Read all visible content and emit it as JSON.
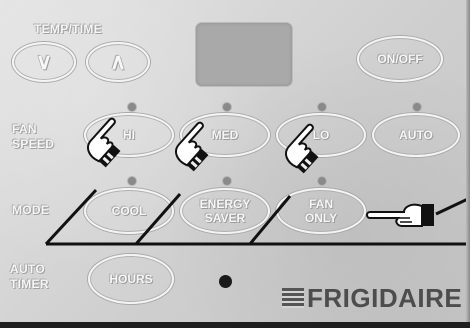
{
  "labels": {
    "temp_time": "TEMP/TIME",
    "fan_speed_line1": "FAN",
    "fan_speed_line2": "SPEED",
    "mode": "MODE",
    "auto_timer_line1": "AUTO",
    "auto_timer_line2": "TIMER"
  },
  "buttons": {
    "down": "∨",
    "up": "∧",
    "on_off": "ON/OFF",
    "hi": "HI",
    "med": "MED",
    "lo": "LO",
    "auto": "AUTO",
    "cool": "COOL",
    "energy_saver_line1": "ENERGY",
    "energy_saver_line2": "SAVER",
    "fan_only_line1": "FAN",
    "fan_only_line2": "ONLY",
    "hours": "HOURS"
  },
  "brand": {
    "name": "FRIGIDAIRE"
  },
  "pointers": {
    "icon": "pointing-hand-icon",
    "count": 4
  },
  "colors": {
    "panel": "#d4d4d4",
    "display": "#a9a9a9",
    "led": "#8a8a8a",
    "label": "#f7f7f7",
    "brand": "#4d4d4d"
  }
}
